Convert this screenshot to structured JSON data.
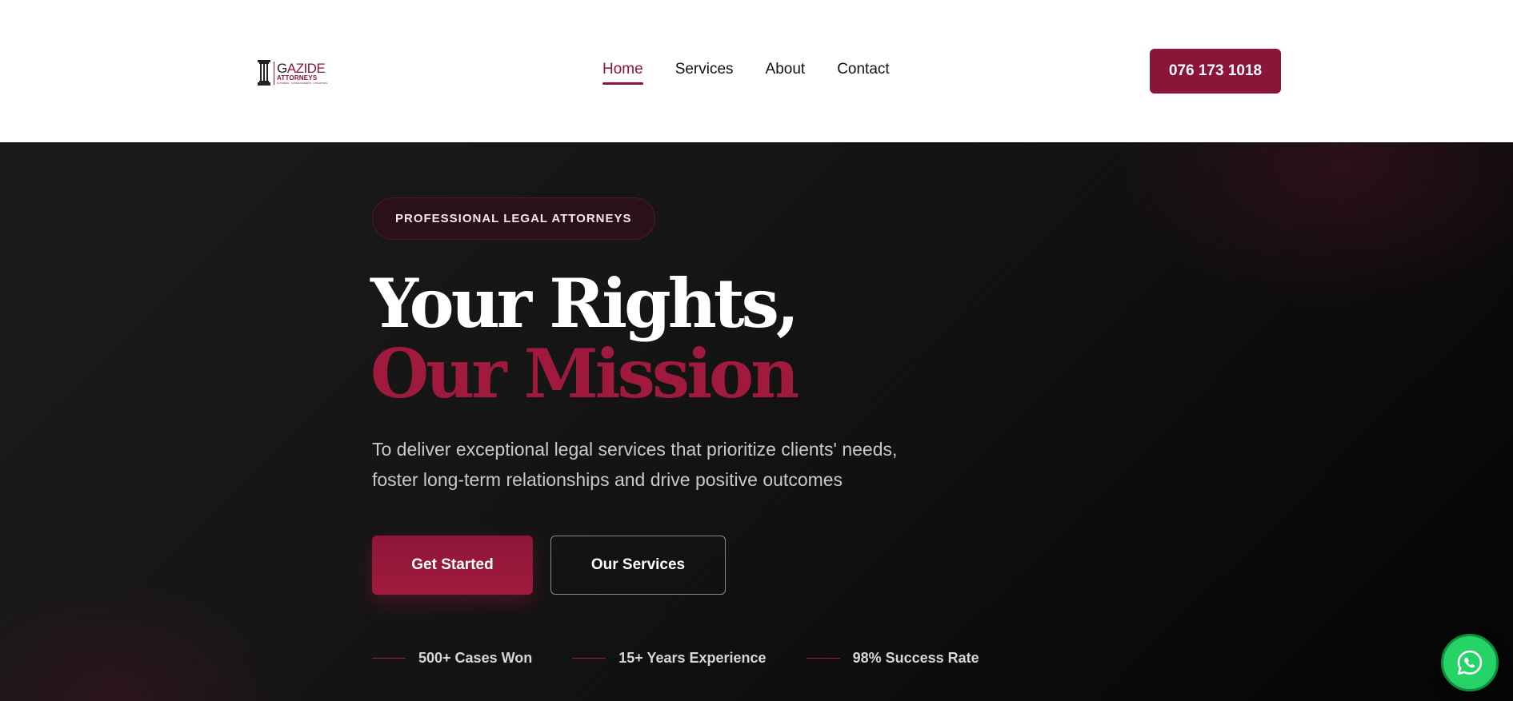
{
  "header": {
    "logo": {
      "name_first_letter": "G",
      "name_rest": "AZIDE",
      "subtitle": "ATTORNEYS",
      "tagline": "NOTARIES · CONVEYANCERS · LITIGATORS"
    },
    "nav": [
      {
        "label": "Home",
        "active": true
      },
      {
        "label": "Services",
        "active": false
      },
      {
        "label": "About",
        "active": false
      },
      {
        "label": "Contact",
        "active": false
      }
    ],
    "phone_button": "076 173 1018"
  },
  "hero": {
    "badge": "PROFESSIONAL LEGAL ATTORNEYS",
    "headline_line1": "Your Rights,",
    "headline_line2": "Our Mission",
    "subtitle_line1": "To deliver exceptional legal services that prioritize clients' needs,",
    "subtitle_line2": "foster long-term relationships and drive positive outcomes",
    "primary_button": "Get Started",
    "secondary_button": "Our Services",
    "stats": [
      {
        "label": "500+ Cases Won"
      },
      {
        "label": "15+ Years Experience"
      },
      {
        "label": "98% Success Rate"
      }
    ]
  },
  "floating": {
    "whatsapp_icon": "whatsapp-icon"
  },
  "colors": {
    "brand": "#8a1538",
    "accent": "#a01a3e",
    "hero_bg": "#141414",
    "whatsapp": "#25d366"
  }
}
